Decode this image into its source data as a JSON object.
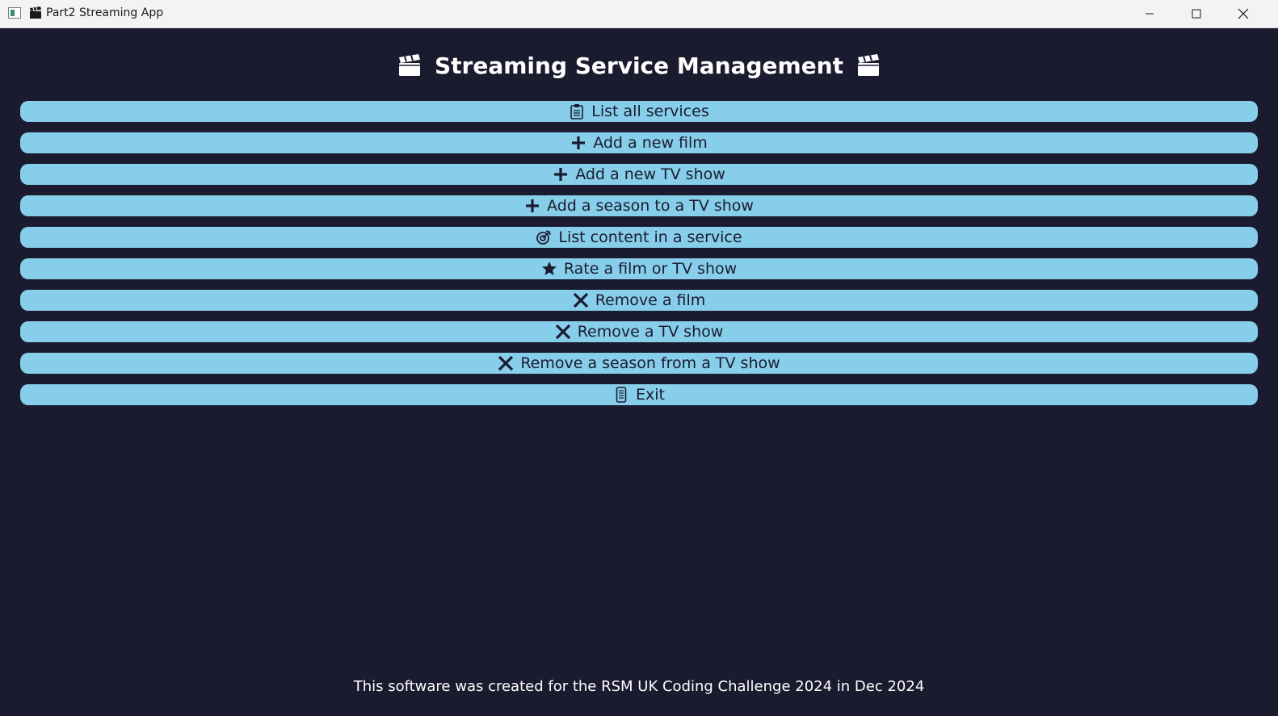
{
  "window": {
    "title": "Part2 Streaming App",
    "controls": [
      "minimize-icon",
      "maximize-icon",
      "close-icon"
    ]
  },
  "header": {
    "title": "Streaming Service Management",
    "icon_left": "clapperboard-icon",
    "icon_right": "clapperboard-icon"
  },
  "menu": [
    {
      "label": "List all services",
      "icon": "clipboard-icon"
    },
    {
      "label": "Add a new film",
      "icon": "plus-icon"
    },
    {
      "label": "Add a new TV show",
      "icon": "plus-icon"
    },
    {
      "label": "Add a season to a TV show",
      "icon": "plus-icon"
    },
    {
      "label": "List content in a service",
      "icon": "target-arrow-icon"
    },
    {
      "label": "Rate a film or TV show",
      "icon": "star-icon"
    },
    {
      "label": "Remove a film",
      "icon": "x-icon"
    },
    {
      "label": "Remove a TV show",
      "icon": "x-icon"
    },
    {
      "label": "Remove a season from a TV show",
      "icon": "x-icon"
    },
    {
      "label": "Exit",
      "icon": "mobile-phone-icon"
    }
  ],
  "footer": {
    "text": "This software was created for the RSM UK Coding Challenge 2024 in Dec 2024"
  },
  "colors": {
    "background": "#1b1b2f",
    "button": "#87ceeb",
    "text_dark": "#1b1b2f",
    "text_light": "#ffffff",
    "titlebar": "#f3f3f3"
  }
}
